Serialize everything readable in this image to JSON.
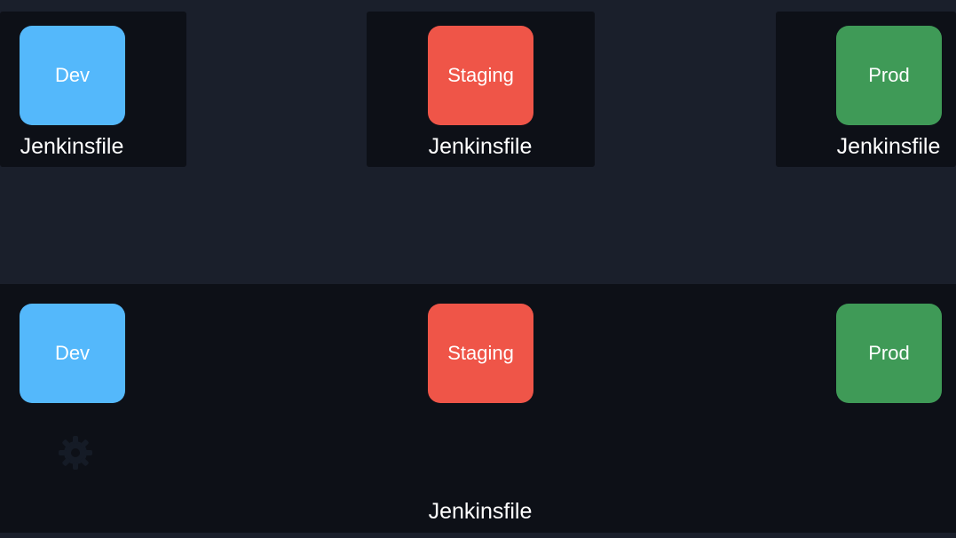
{
  "top_row": {
    "dev": {
      "label": "Dev",
      "file": "Jenkinsfile"
    },
    "staging": {
      "label": "Staging",
      "file": "Jenkinsfile"
    },
    "prod": {
      "label": "Prod",
      "file": "Jenkinsfile"
    }
  },
  "bottom_row": {
    "dev_label": "Dev",
    "staging_label": "Staging",
    "prod_label": "Prod",
    "shared_file": "Jenkinsfile"
  },
  "colors": {
    "dev": "#54b8fb",
    "staging": "#ef5548",
    "prod": "#3f9a57",
    "background": "#1a1f2b",
    "panel": "#0d1017"
  },
  "icons": {
    "faint_gear": "gear-icon"
  }
}
